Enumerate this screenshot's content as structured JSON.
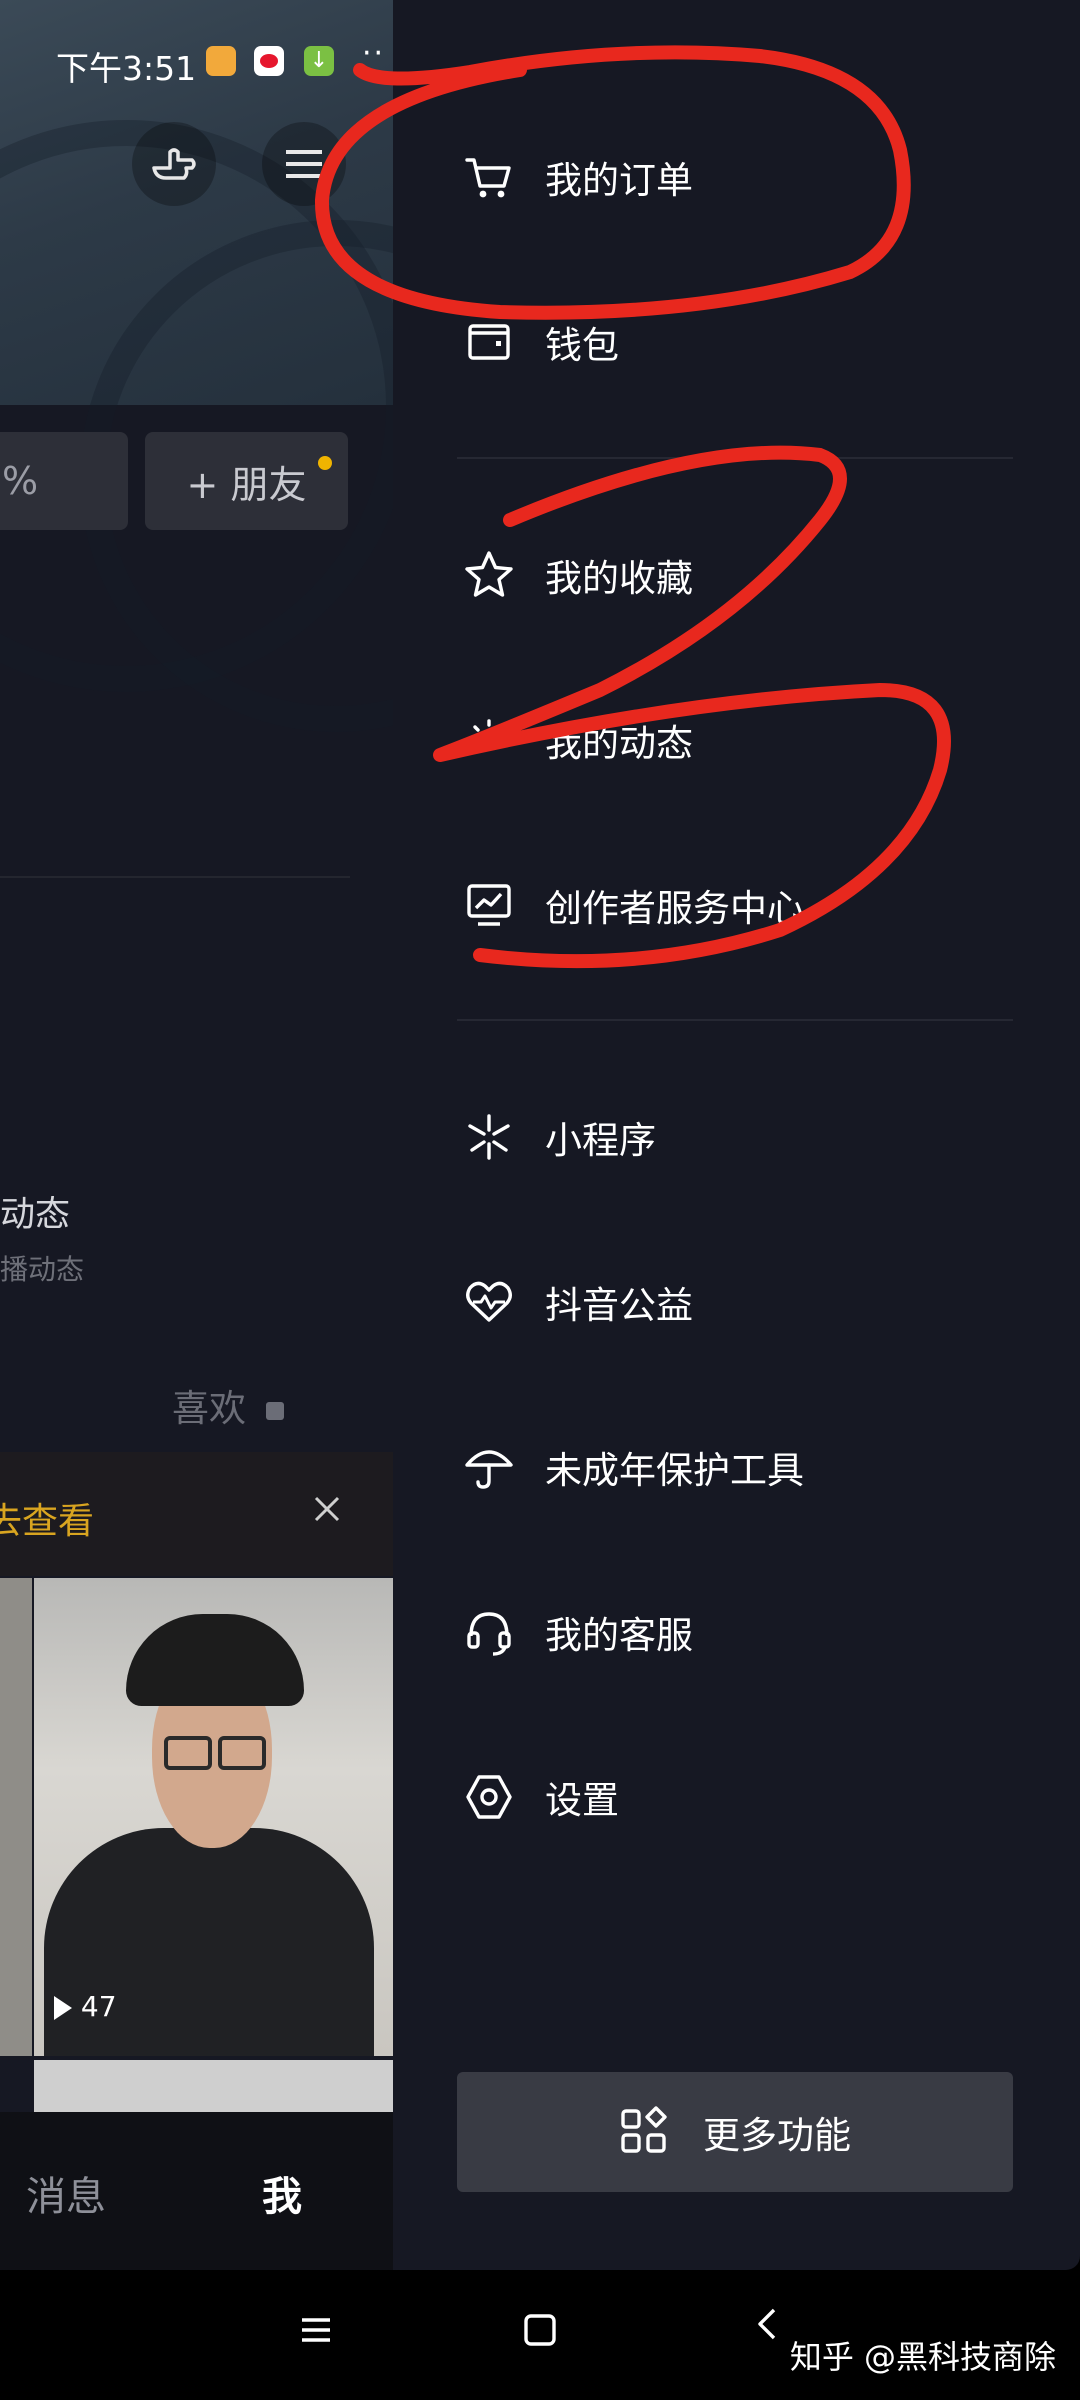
{
  "status_bar": {
    "time": "下午3:51"
  },
  "background_app": {
    "add_friend_label": "+ 朋友",
    "partial_left_pill": "%",
    "section_title_partial": "动态",
    "section_sub_partial": "播动态",
    "likes_tab": "喜欢",
    "promo_text_partial": "去查看",
    "video_play_count": "47",
    "nav_messages": "消息",
    "nav_me": "我"
  },
  "drawer": {
    "group1": [
      {
        "label": "我的订单",
        "icon": "shopping-cart-icon"
      },
      {
        "label": "钱包",
        "icon": "wallet-icon"
      }
    ],
    "group2": [
      {
        "label": "我的收藏",
        "icon": "star-icon"
      },
      {
        "label": "我的动态",
        "icon": "sparkle-icon"
      },
      {
        "label": "创作者服务中心",
        "icon": "chart-monitor-icon"
      }
    ],
    "group3": [
      {
        "label": "小程序",
        "icon": "mini-program-icon"
      },
      {
        "label": "抖音公益",
        "icon": "heart-charity-icon"
      },
      {
        "label": "未成年保护工具",
        "icon": "umbrella-icon"
      },
      {
        "label": "我的客服",
        "icon": "headset-icon"
      },
      {
        "label": "设置",
        "icon": "settings-hexagon-icon"
      }
    ],
    "more_label": "更多功能"
  },
  "watermark": "知乎 @黑科技商除",
  "colors": {
    "drawer_bg": "#161823",
    "annotation_red": "#e8281e",
    "badge": "#f0b400",
    "promo_text": "#d9a520"
  }
}
